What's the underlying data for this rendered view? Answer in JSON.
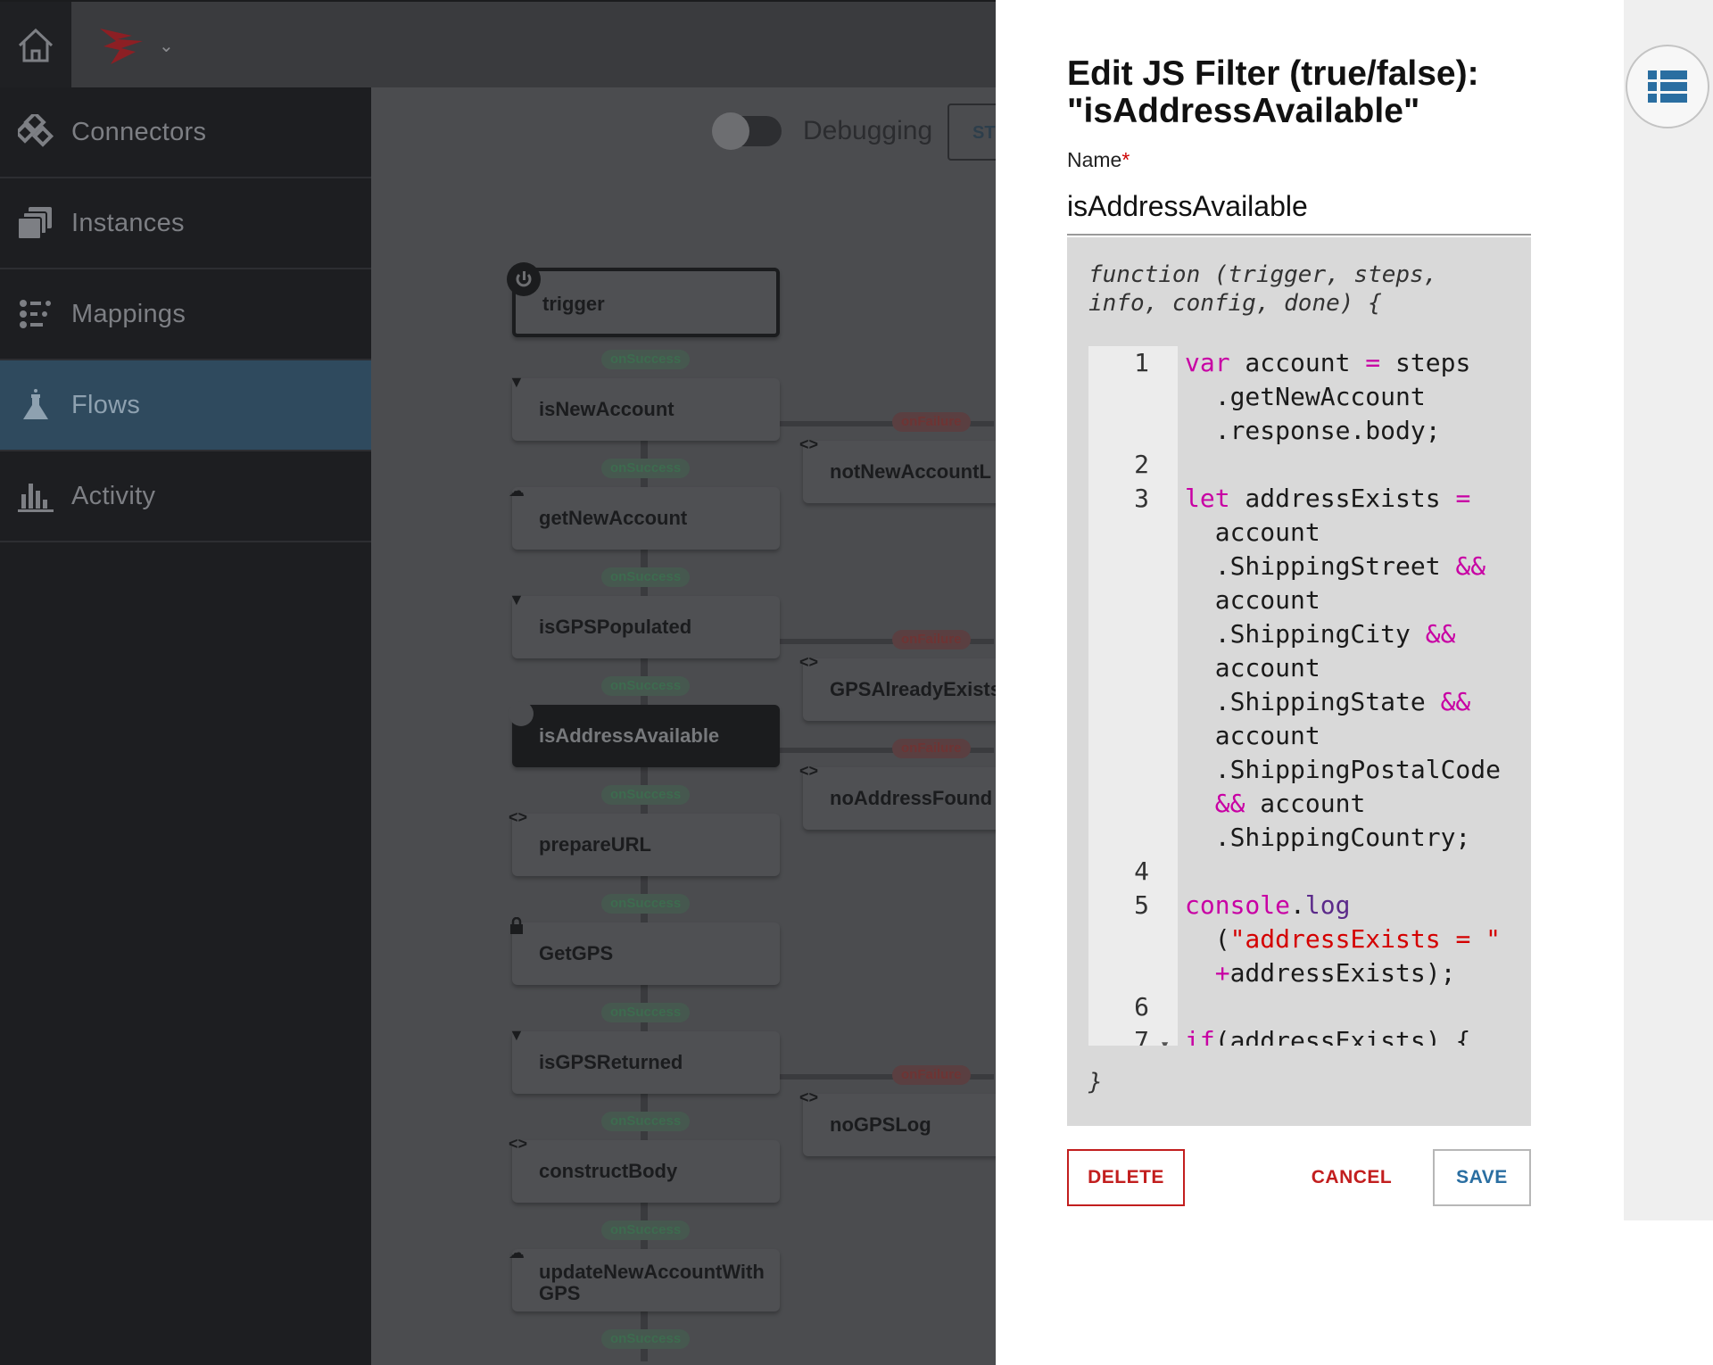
{
  "sidebar": {
    "items": [
      {
        "label": "Connectors",
        "icon": "connectors-icon"
      },
      {
        "label": "Instances",
        "icon": "instances-icon"
      },
      {
        "label": "Mappings",
        "icon": "mappings-icon"
      },
      {
        "label": "Flows",
        "icon": "flask-icon",
        "active": true
      },
      {
        "label": "Activity",
        "icon": "bar-chart-icon"
      }
    ]
  },
  "toolbar": {
    "debugging_label": "Debugging",
    "start_button_label": "ST"
  },
  "flow": {
    "steps": {
      "trigger": "trigger",
      "isNewAccount": "isNewAccount",
      "getNewAccount": "getNewAccount",
      "isGPSPopulated": "isGPSPopulated",
      "isAddressAvailable": "isAddressAvailable",
      "prepareURL": "prepareURL",
      "GetGPS": "GetGPS",
      "isGPSReturned": "isGPSReturned",
      "constructBody": "constructBody",
      "updateNewAccountWithGPS": "updateNewAccountWithGPS"
    },
    "side_steps": {
      "notNewAccountLog": "notNewAccountL",
      "GPSAlreadyExists": "GPSAlreadyExists",
      "noAddressFound": "noAddressFound",
      "noGPSLog": "noGPSLog"
    },
    "success_label": "onSuccess",
    "failure_label": "onFailure"
  },
  "modal": {
    "title": "Edit JS Filter (true/false): \"isAddressAvailable\"",
    "name_label": "Name",
    "required_mark": "*",
    "name_value": "isAddressAvailable",
    "code_header": "function (trigger, steps, info, config, done) {",
    "code_footer": "}",
    "delete_label": "DELETE",
    "cancel_label": "CANCEL",
    "save_label": "SAVE"
  },
  "colors": {
    "danger": "#c21e1e",
    "primary": "#2a6ea1",
    "active_nav": "#2f4a5e",
    "keyword": "#c800a4",
    "string": "#d40000"
  }
}
